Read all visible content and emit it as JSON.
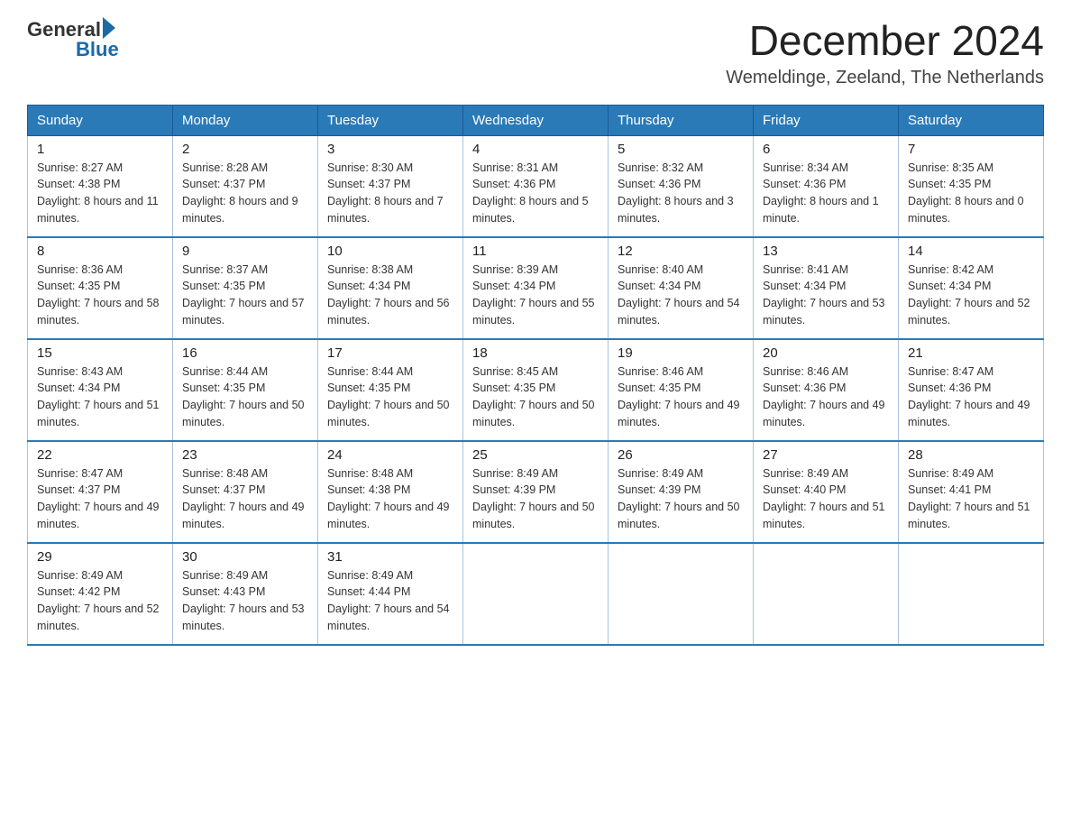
{
  "header": {
    "logo_general": "General",
    "logo_blue": "Blue",
    "month_title": "December 2024",
    "location": "Wemeldinge, Zeeland, The Netherlands"
  },
  "days_of_week": [
    "Sunday",
    "Monday",
    "Tuesday",
    "Wednesday",
    "Thursday",
    "Friday",
    "Saturday"
  ],
  "weeks": [
    [
      {
        "day": "1",
        "sunrise": "8:27 AM",
        "sunset": "4:38 PM",
        "daylight": "8 hours and 11 minutes."
      },
      {
        "day": "2",
        "sunrise": "8:28 AM",
        "sunset": "4:37 PM",
        "daylight": "8 hours and 9 minutes."
      },
      {
        "day": "3",
        "sunrise": "8:30 AM",
        "sunset": "4:37 PM",
        "daylight": "8 hours and 7 minutes."
      },
      {
        "day": "4",
        "sunrise": "8:31 AM",
        "sunset": "4:36 PM",
        "daylight": "8 hours and 5 minutes."
      },
      {
        "day": "5",
        "sunrise": "8:32 AM",
        "sunset": "4:36 PM",
        "daylight": "8 hours and 3 minutes."
      },
      {
        "day": "6",
        "sunrise": "8:34 AM",
        "sunset": "4:36 PM",
        "daylight": "8 hours and 1 minute."
      },
      {
        "day": "7",
        "sunrise": "8:35 AM",
        "sunset": "4:35 PM",
        "daylight": "8 hours and 0 minutes."
      }
    ],
    [
      {
        "day": "8",
        "sunrise": "8:36 AM",
        "sunset": "4:35 PM",
        "daylight": "7 hours and 58 minutes."
      },
      {
        "day": "9",
        "sunrise": "8:37 AM",
        "sunset": "4:35 PM",
        "daylight": "7 hours and 57 minutes."
      },
      {
        "day": "10",
        "sunrise": "8:38 AM",
        "sunset": "4:34 PM",
        "daylight": "7 hours and 56 minutes."
      },
      {
        "day": "11",
        "sunrise": "8:39 AM",
        "sunset": "4:34 PM",
        "daylight": "7 hours and 55 minutes."
      },
      {
        "day": "12",
        "sunrise": "8:40 AM",
        "sunset": "4:34 PM",
        "daylight": "7 hours and 54 minutes."
      },
      {
        "day": "13",
        "sunrise": "8:41 AM",
        "sunset": "4:34 PM",
        "daylight": "7 hours and 53 minutes."
      },
      {
        "day": "14",
        "sunrise": "8:42 AM",
        "sunset": "4:34 PM",
        "daylight": "7 hours and 52 minutes."
      }
    ],
    [
      {
        "day": "15",
        "sunrise": "8:43 AM",
        "sunset": "4:34 PM",
        "daylight": "7 hours and 51 minutes."
      },
      {
        "day": "16",
        "sunrise": "8:44 AM",
        "sunset": "4:35 PM",
        "daylight": "7 hours and 50 minutes."
      },
      {
        "day": "17",
        "sunrise": "8:44 AM",
        "sunset": "4:35 PM",
        "daylight": "7 hours and 50 minutes."
      },
      {
        "day": "18",
        "sunrise": "8:45 AM",
        "sunset": "4:35 PM",
        "daylight": "7 hours and 50 minutes."
      },
      {
        "day": "19",
        "sunrise": "8:46 AM",
        "sunset": "4:35 PM",
        "daylight": "7 hours and 49 minutes."
      },
      {
        "day": "20",
        "sunrise": "8:46 AM",
        "sunset": "4:36 PM",
        "daylight": "7 hours and 49 minutes."
      },
      {
        "day": "21",
        "sunrise": "8:47 AM",
        "sunset": "4:36 PM",
        "daylight": "7 hours and 49 minutes."
      }
    ],
    [
      {
        "day": "22",
        "sunrise": "8:47 AM",
        "sunset": "4:37 PM",
        "daylight": "7 hours and 49 minutes."
      },
      {
        "day": "23",
        "sunrise": "8:48 AM",
        "sunset": "4:37 PM",
        "daylight": "7 hours and 49 minutes."
      },
      {
        "day": "24",
        "sunrise": "8:48 AM",
        "sunset": "4:38 PM",
        "daylight": "7 hours and 49 minutes."
      },
      {
        "day": "25",
        "sunrise": "8:49 AM",
        "sunset": "4:39 PM",
        "daylight": "7 hours and 50 minutes."
      },
      {
        "day": "26",
        "sunrise": "8:49 AM",
        "sunset": "4:39 PM",
        "daylight": "7 hours and 50 minutes."
      },
      {
        "day": "27",
        "sunrise": "8:49 AM",
        "sunset": "4:40 PM",
        "daylight": "7 hours and 51 minutes."
      },
      {
        "day": "28",
        "sunrise": "8:49 AM",
        "sunset": "4:41 PM",
        "daylight": "7 hours and 51 minutes."
      }
    ],
    [
      {
        "day": "29",
        "sunrise": "8:49 AM",
        "sunset": "4:42 PM",
        "daylight": "7 hours and 52 minutes."
      },
      {
        "day": "30",
        "sunrise": "8:49 AM",
        "sunset": "4:43 PM",
        "daylight": "7 hours and 53 minutes."
      },
      {
        "day": "31",
        "sunrise": "8:49 AM",
        "sunset": "4:44 PM",
        "daylight": "7 hours and 54 minutes."
      },
      null,
      null,
      null,
      null
    ]
  ]
}
